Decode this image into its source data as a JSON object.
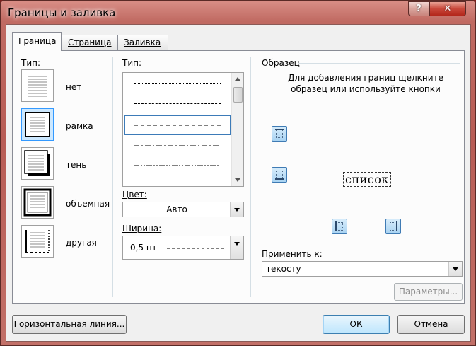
{
  "window": {
    "title": "Границы и заливка",
    "help_label": "?",
    "close_label": "✕"
  },
  "tabs": [
    {
      "label": "Граница",
      "active": true
    },
    {
      "label": "Страница",
      "active": false
    },
    {
      "label": "Заливка",
      "active": false
    }
  ],
  "presets": {
    "label": "Тип:",
    "items": [
      {
        "label": "нет",
        "selected": false
      },
      {
        "label": "рамка",
        "selected": true
      },
      {
        "label": "тень",
        "selected": false
      },
      {
        "label": "объемная",
        "selected": false
      },
      {
        "label": "другая",
        "selected": false
      }
    ]
  },
  "style": {
    "label": "Тип:",
    "items": [
      "dotted",
      "dashed-dense",
      "dashed",
      "dash-dot",
      "dash-dot-dot"
    ],
    "selected_index": 2
  },
  "color": {
    "label": "Цвет:",
    "value": "Авто"
  },
  "width": {
    "label": "Ширина:",
    "value": "0,5 пт"
  },
  "sample": {
    "label": "Образец",
    "hint": "Для добавления границ щелкните образец или используйте кнопки",
    "word": "список"
  },
  "apply_to": {
    "label": "Применить к:",
    "value": "текосту"
  },
  "buttons": {
    "options": "Параметры...",
    "horizontal_line": "Горизонтальная линия...",
    "ok": "ОК",
    "cancel": "Отмена"
  },
  "colors": {
    "selection": "#3399ff",
    "title_bar": "#c06a62"
  }
}
